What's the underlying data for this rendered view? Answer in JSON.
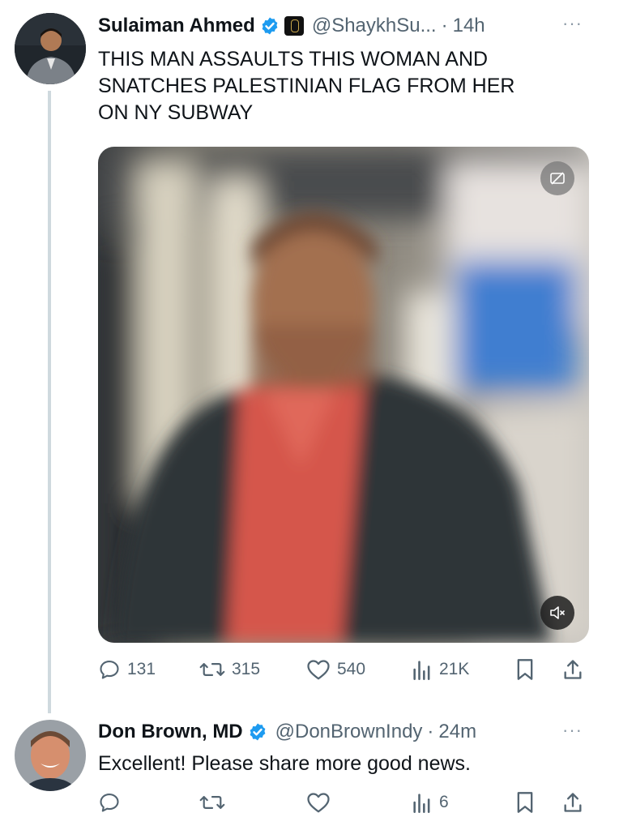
{
  "tweet1": {
    "name": "Sulaiman Ahmed",
    "handle": "@ShaykhSu...",
    "separator": "·",
    "time": "14h",
    "more": "···",
    "text_lines": [
      "THIS MAN ASSAULTS THIS WOMAN AND",
      "SNATCHES PALESTINIAN FLAG FROM HER",
      "ON NY SUBWAY"
    ],
    "stats": {
      "replies": "131",
      "retweets": "315",
      "likes": "540",
      "views": "21K"
    },
    "media": {
      "type": "video",
      "muted": true
    }
  },
  "tweet2": {
    "name": "Don Brown, MD",
    "handle": "@DonBrownIndy",
    "separator": "·",
    "time": "24m",
    "more": "···",
    "text": "Excellent! Please share more good news.",
    "stats": {
      "views": "6"
    }
  },
  "colors": {
    "verified": "#1d9bf0",
    "muted_text": "#536471",
    "thread_line": "#cfd9de"
  },
  "icons": [
    "verified-badge-icon",
    "reply-icon",
    "retweet-icon",
    "like-icon",
    "views-icon",
    "bookmark-icon",
    "share-icon",
    "mute-icon",
    "hide-media-icon"
  ]
}
